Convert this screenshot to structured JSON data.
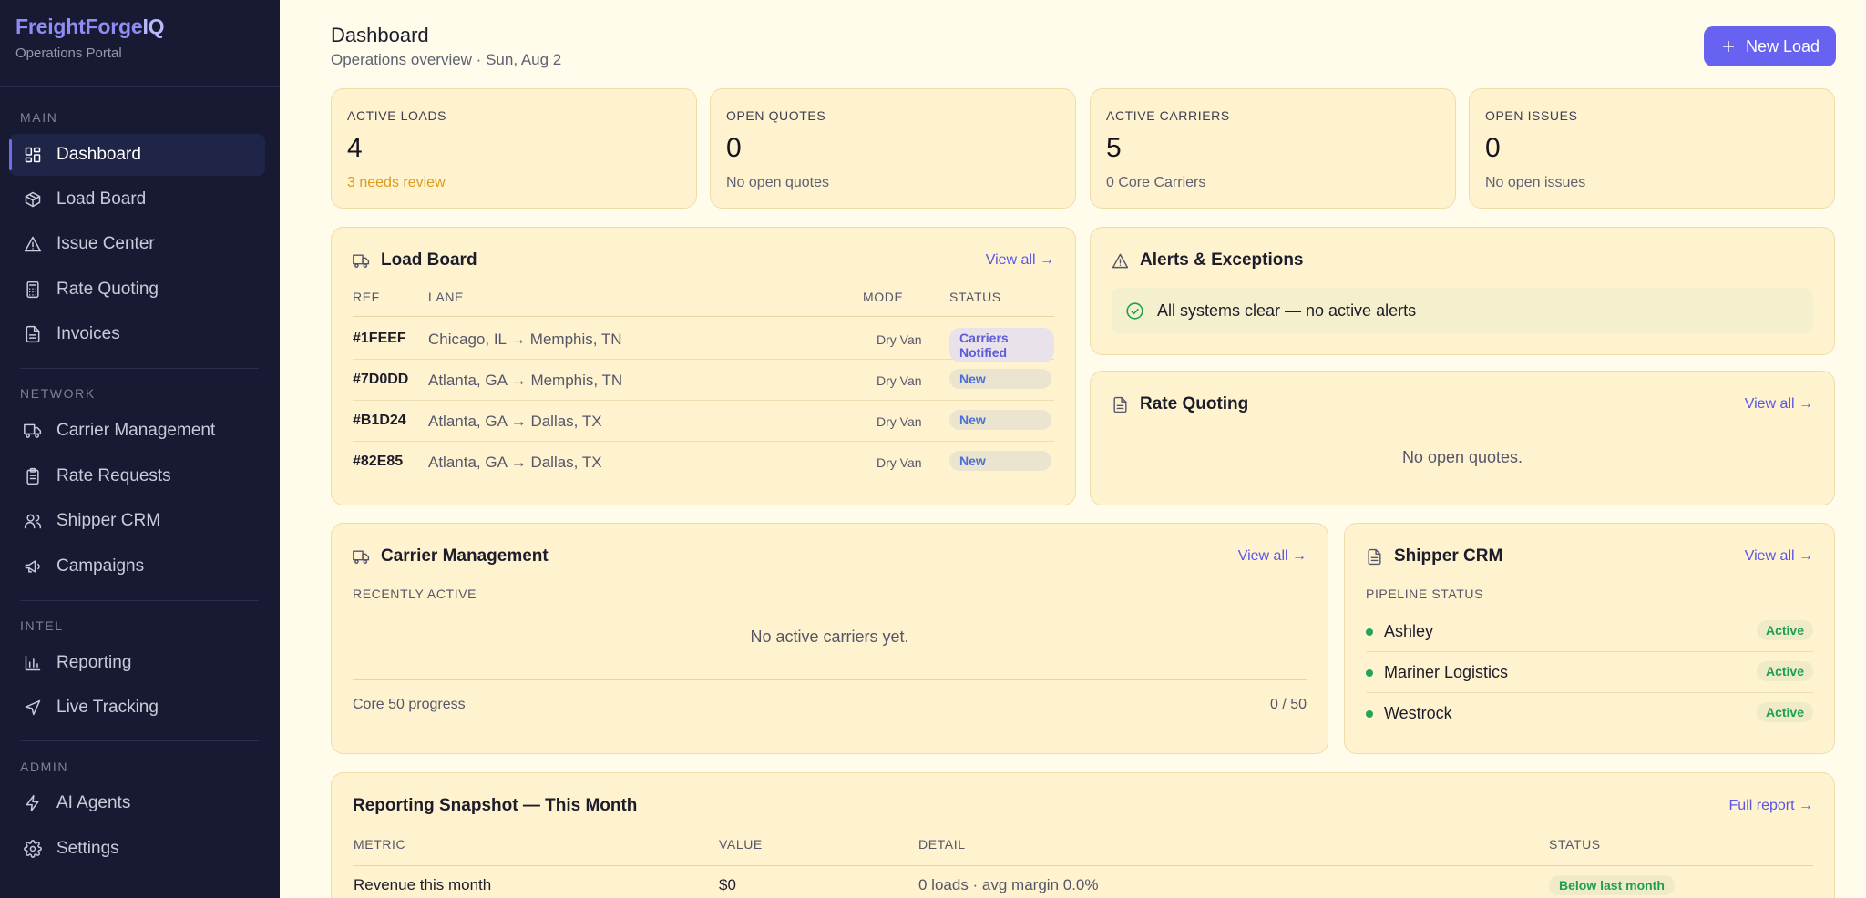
{
  "brand": {
    "name": "FreightForge",
    "name_suffix": "IQ",
    "subtitle": "Operations Portal"
  },
  "sidebar": {
    "sections": {
      "main": "MAIN",
      "network": "NETWORK",
      "intel": "INTEL",
      "admin": "ADMIN"
    },
    "items": {
      "dashboard": "Dashboard",
      "load_board": "Load Board",
      "issue_center": "Issue Center",
      "rate_quoting": "Rate Quoting",
      "invoices": "Invoices",
      "carrier_management": "Carrier Management",
      "rate_requests": "Rate Requests",
      "shipper_crm": "Shipper CRM",
      "campaigns": "Campaigns",
      "reporting": "Reporting",
      "live_tracking": "Live Tracking",
      "ai_agents": "AI Agents",
      "settings": "Settings"
    },
    "active": "dashboard"
  },
  "header": {
    "title": "Dashboard",
    "subtitle": "Operations overview · Sun, Aug 2",
    "new_load_label": "New Load"
  },
  "stats": [
    {
      "label": "ACTIVE LOADS",
      "value": "4",
      "note": "3 needs review"
    },
    {
      "label": "OPEN QUOTES",
      "value": "0",
      "note": "No open quotes"
    },
    {
      "label": "ACTIVE CARRIERS",
      "value": "5",
      "note": "0 Core Carriers"
    },
    {
      "label": "OPEN ISSUES",
      "value": "0",
      "note": "No open issues"
    }
  ],
  "load_board": {
    "title": "Load Board",
    "view_all": "View all →",
    "columns": {
      "ref": "REF",
      "lane": "LANE",
      "mode": "MODE",
      "status": "STATUS"
    },
    "rows": [
      {
        "ref": "#1FEEF",
        "lane": "Chicago, IL → Memphis, TN",
        "mode": "Dry Van",
        "status": "Carriers Notified"
      },
      {
        "ref": "#7D0DD",
        "lane": "Atlanta, GA → Memphis, TN",
        "mode": "Dry Van",
        "status": "New"
      },
      {
        "ref": "#B1D24",
        "lane": "Atlanta, GA → Dallas, TX",
        "mode": "Dry Van",
        "status": "New"
      },
      {
        "ref": "#82E85",
        "lane": "Atlanta, GA → Dallas, TX",
        "mode": "Dry Van",
        "status": "New"
      }
    ]
  },
  "alerts": {
    "title": "Alerts & Exceptions",
    "message": "All systems clear — no active alerts"
  },
  "rate_quoting": {
    "title": "Rate Quoting",
    "view_all": "View all →",
    "empty": "No open quotes."
  },
  "carrier_management": {
    "title": "Carrier Management",
    "view_all": "View all →",
    "sub_label": "RECENTLY ACTIVE",
    "empty": "No active carriers yet.",
    "progress_label": "Core 50 progress",
    "progress_count": "0 / 50"
  },
  "shipper_crm": {
    "title": "Shipper CRM",
    "view_all": "View all →",
    "sub_label": "PIPELINE STATUS",
    "rows": [
      {
        "name": "Ashley",
        "status": "Active"
      },
      {
        "name": "Mariner Logistics",
        "status": "Active"
      },
      {
        "name": "Westrock",
        "status": "Active"
      }
    ]
  },
  "reporting": {
    "title": "Reporting Snapshot — This Month",
    "full_report": "Full report →",
    "columns": {
      "metric": "METRIC",
      "value": "VALUE",
      "detail": "DETAIL",
      "status": "STATUS"
    },
    "rows": [
      {
        "metric": "Revenue this month",
        "value": "$0",
        "detail": "0 loads · avg margin 0.0%",
        "status": "Below last month"
      }
    ]
  },
  "colors": {
    "sidebar_bg": "#181a33",
    "accent": "#6763f0",
    "page_bg": "#fffcec",
    "card_bg": "#fff3cf",
    "success": "#1e9e55",
    "warning": "#e09a16"
  }
}
